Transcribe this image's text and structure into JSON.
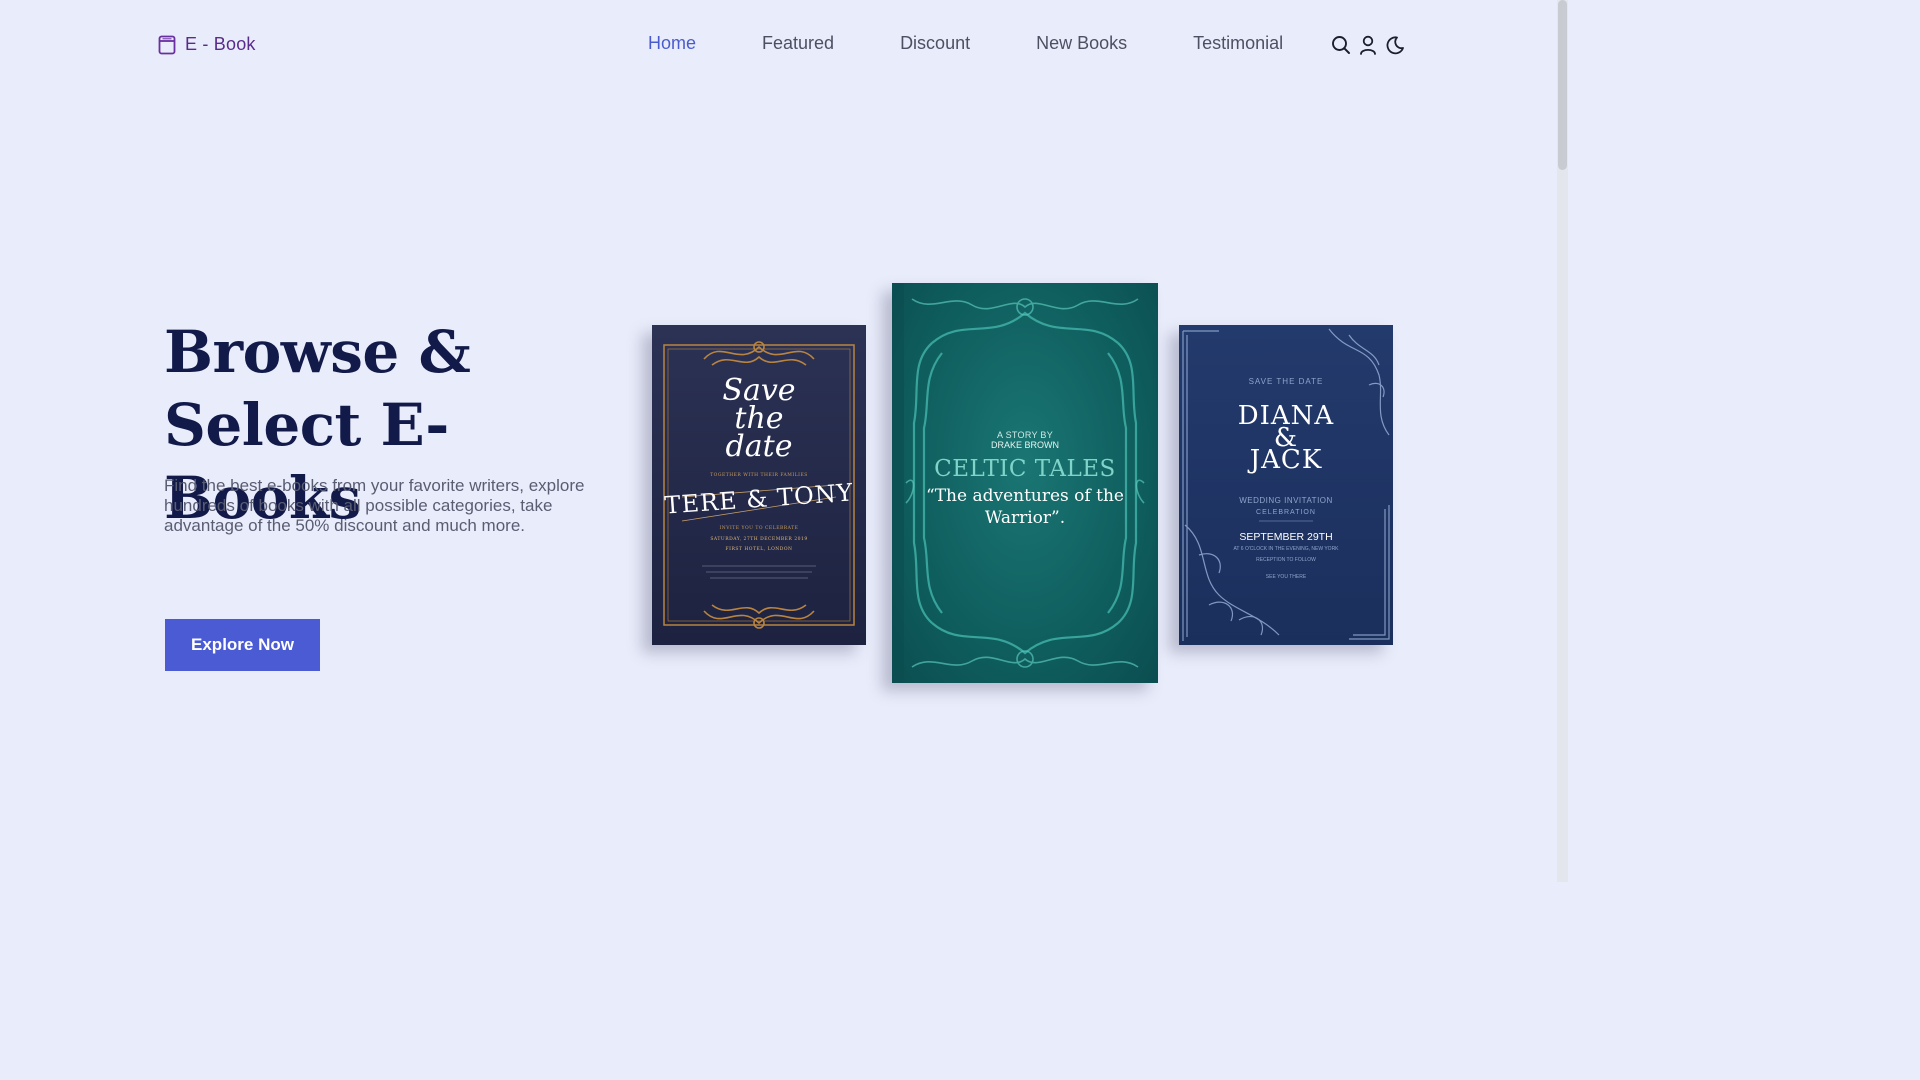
{
  "brand": {
    "name": "E - Book",
    "icon": "book-icon"
  },
  "nav": {
    "items": [
      {
        "label": "Home",
        "active": true
      },
      {
        "label": "Featured",
        "active": false
      },
      {
        "label": "Discount",
        "active": false
      },
      {
        "label": "New Books",
        "active": false
      },
      {
        "label": "Testimonial",
        "active": false
      }
    ]
  },
  "header_actions": [
    {
      "icon": "search-icon"
    },
    {
      "icon": "user-icon"
    },
    {
      "icon": "moon-icon"
    }
  ],
  "hero": {
    "title_line1": "Browse &",
    "title_line2": "Select E-Books",
    "description": "Find the best e-books from your favorite writers, explore hundreds of books with all possible categories, take advantage of the 50% discount and much more.",
    "cta_label": "Explore Now"
  },
  "books": {
    "left": {
      "script_line1": "Save",
      "script_line2": "the",
      "script_line3": "date",
      "together_line": "TOGETHER WITH THEIR FAMILIES",
      "names": "TERE & TONY",
      "invite_line": "INVITE YOU TO CELEBRATE",
      "date_line": "SATURDAY, 27TH DECEMBER 2019",
      "venue_line": "FIRST HOTEL, LONDON"
    },
    "center": {
      "story_by": "A STORY BY",
      "author": "DRAKE BROWN",
      "title": "CELTIC TALES",
      "subtitle": "“The adventures of the Warrior”."
    },
    "right": {
      "save_the_date": "SAVE THE DATE",
      "name1": "DIANA",
      "amp": "&",
      "name2": "JACK",
      "invitation": "WEDDING INVITATION",
      "celebration": "CELEBRATION",
      "date": "SEPTEMBER 29TH",
      "time": "AT 6 O'CLOCK IN THE EVENING, NEW YORK",
      "reception": "RECEPTION TO FOLLOW",
      "see_you": "SEE YOU THERE"
    }
  },
  "colors": {
    "background": "#e9edfb",
    "accent": "#4b5bd3",
    "brand": "#5a2a8c",
    "heading": "#121a4a"
  }
}
